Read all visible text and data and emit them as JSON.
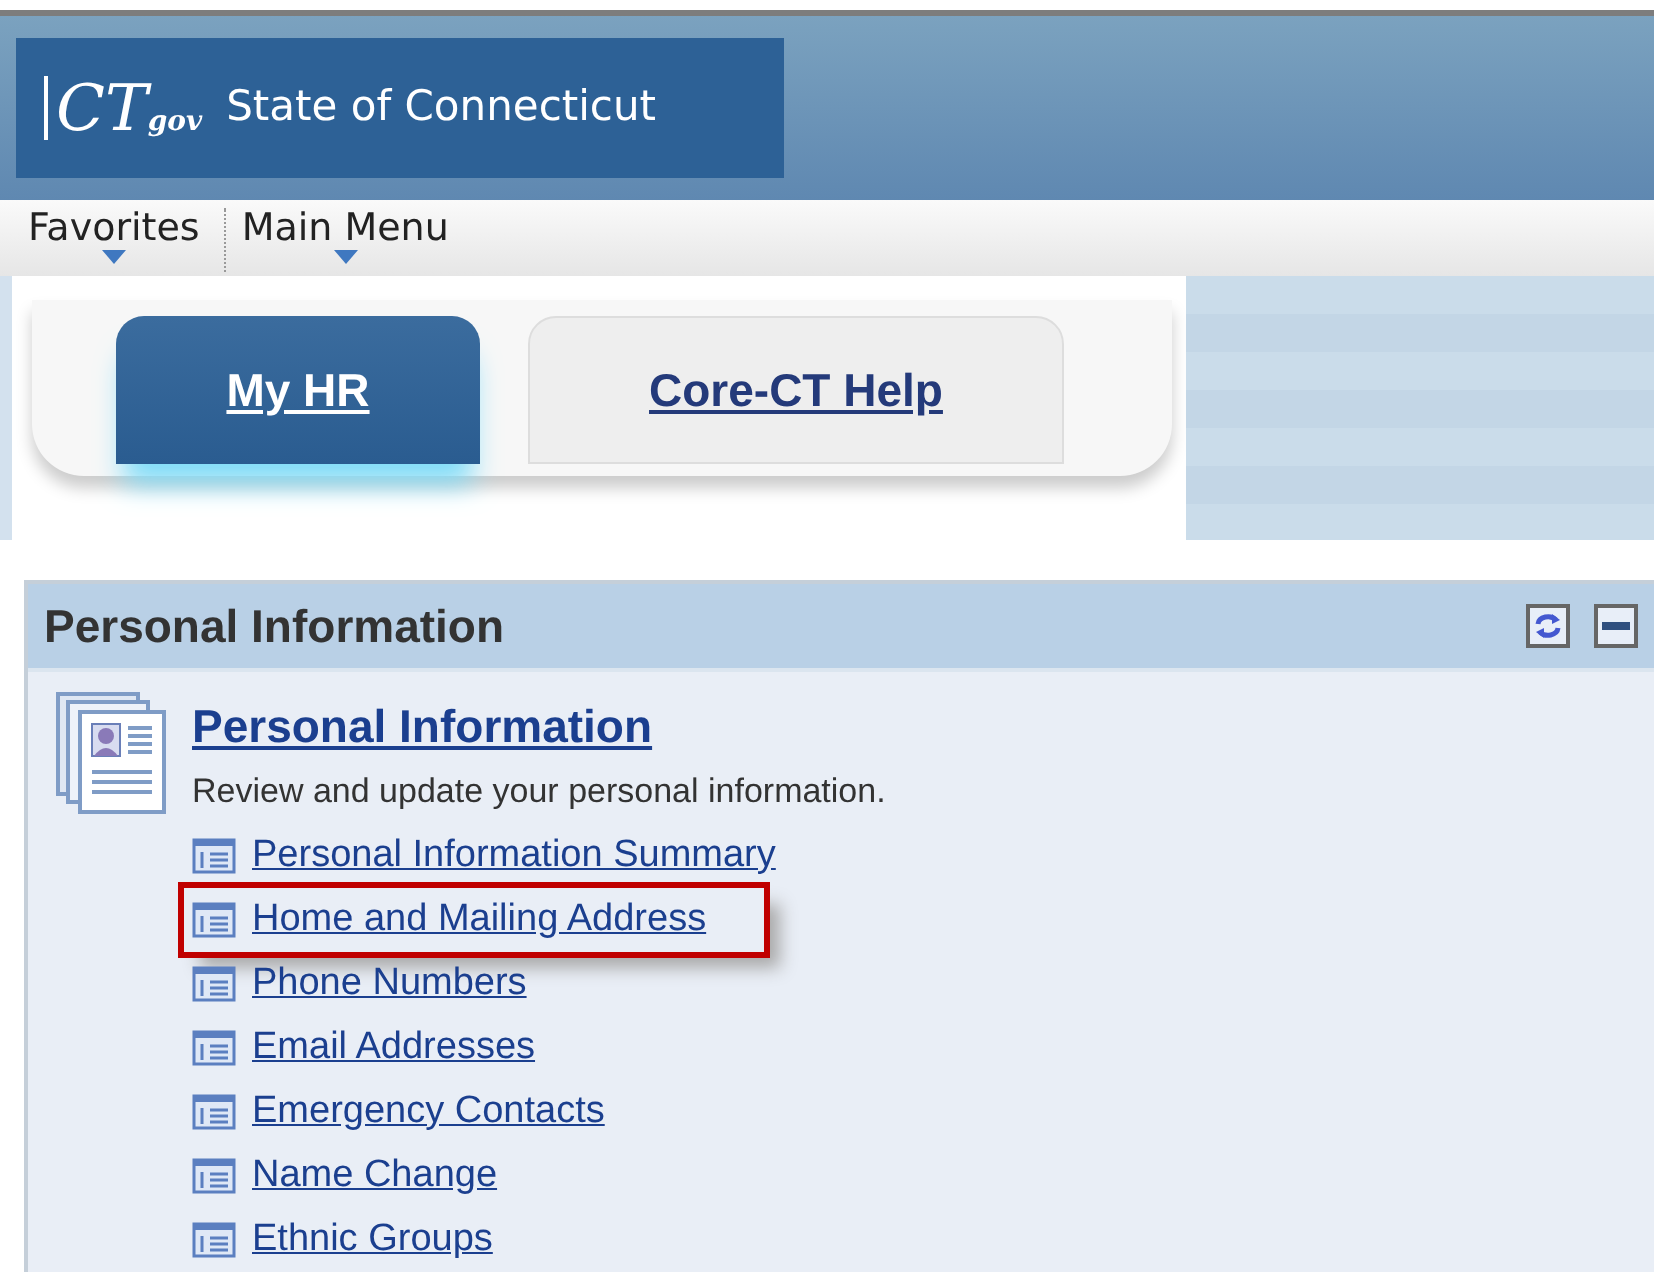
{
  "header": {
    "logo": {
      "mark": "CT",
      "suffix": "gov"
    },
    "title": "State of Connecticut"
  },
  "menu_bar": [
    {
      "label": "Favorites"
    },
    {
      "label": "Main Menu"
    }
  ],
  "tabs": [
    {
      "label": "My HR",
      "selected": true
    },
    {
      "label": "Core-CT Help",
      "selected": false
    }
  ],
  "portlet": {
    "title": "Personal Information",
    "section": {
      "title": "Personal Information",
      "description": "Review and update your personal information.",
      "links": [
        {
          "label": "Personal Information Summary",
          "highlighted": false
        },
        {
          "label": "Home and Mailing Address",
          "highlighted": true
        },
        {
          "label": "Phone Numbers",
          "highlighted": false
        },
        {
          "label": "Email Addresses",
          "highlighted": false
        },
        {
          "label": "Emergency Contacts",
          "highlighted": false
        },
        {
          "label": "Name Change",
          "highlighted": false
        },
        {
          "label": "Ethnic Groups",
          "highlighted": false
        }
      ]
    }
  }
}
